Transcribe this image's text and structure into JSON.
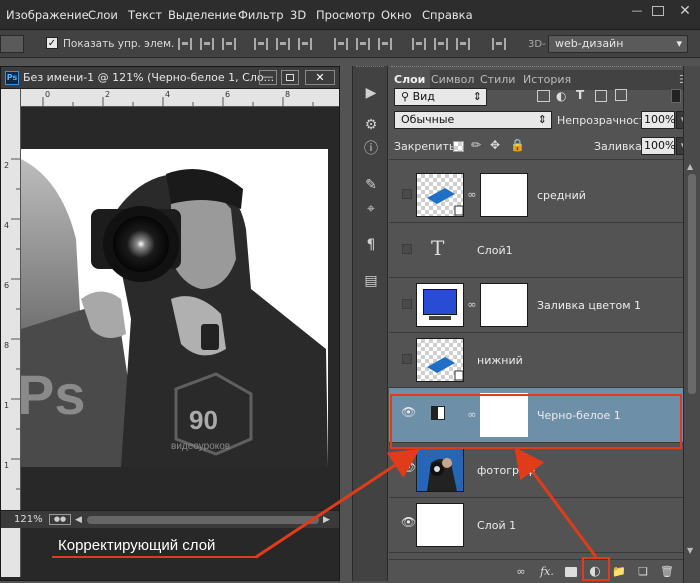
{
  "menu": [
    "Изображение",
    "Слои",
    "Текст",
    "Выделение",
    "Фильтр",
    "3D",
    "Просмотр",
    "Окно",
    "Справка"
  ],
  "options_bar": {
    "show_controls_label": "Показать упр. элем.",
    "workspace_prefix": "3D-",
    "workspace": "web-дизайн"
  },
  "document": {
    "title": "Без имени-1 @ 121% (Черно-белое 1, Сло...",
    "ps_badge": "Ps",
    "zoom": "121%",
    "ruler_top": [
      "0",
      "2",
      "4",
      "6",
      "8"
    ],
    "ruler_left": [
      "2",
      "4",
      "6",
      "8",
      "1",
      "1",
      "1"
    ],
    "canvas_text": {
      "ps": "Ps",
      "number": "90",
      "caption": "видеоуроков"
    }
  },
  "panel": {
    "tabs": [
      "Слои",
      "Символ",
      "Стили",
      "История"
    ],
    "filter": "Вид",
    "blend_mode": "Обычные",
    "opacity_label": "Непрозрачность:",
    "opacity_value": "100%",
    "lock_label": "Закрепить:",
    "fill_label": "Заливка:",
    "fill_value": "100%",
    "layers": [
      {
        "name": "средний",
        "visible": false
      },
      {
        "name": "Слой1",
        "visible": false,
        "type": "text"
      },
      {
        "name": "Заливка цветом 1",
        "visible": false
      },
      {
        "name": "нижний",
        "visible": false
      },
      {
        "name": "Черно-белое 1",
        "visible": true,
        "selected": true
      },
      {
        "name": "фотограф",
        "visible": true
      },
      {
        "name": "Слой 1",
        "visible": true
      }
    ],
    "bottom_icons": [
      "link-icon",
      "fx",
      "mask-icon",
      "adjustment-icon",
      "folder-icon",
      "new-layer-icon",
      "trash-icon"
    ]
  },
  "annotation": {
    "caption": "Корректирующий слой"
  },
  "colors": {
    "accent": "#e03c1a",
    "selected_row": "#6d8fa8",
    "panel_bg": "#535353",
    "menubar": "#2d2d2d"
  }
}
